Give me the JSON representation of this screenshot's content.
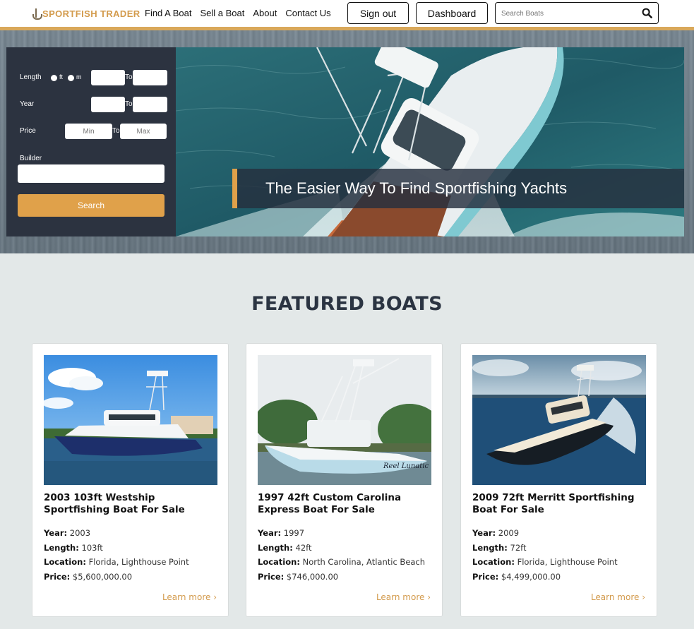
{
  "header": {
    "logo_text": "SPORTFISH TRADER",
    "nav": [
      "Find A Boat",
      "Sell a Boat",
      "About",
      "Contact Us"
    ],
    "signout_label": "Sign out",
    "dashboard_label": "Dashboard",
    "search_placeholder": "Search Boats"
  },
  "search_panel": {
    "length_label": "Length",
    "unit_ft": "ft",
    "unit_m": "m",
    "year_label": "Year",
    "price_label": "Price",
    "to_label": "To",
    "min_placeholder": "Min",
    "max_placeholder": "Max",
    "builder_label": "Builder",
    "search_button": "Search"
  },
  "hero": {
    "caption": "The Easier Way To Find Sportfishing Yachts"
  },
  "featured": {
    "title": "FEATURED BOATS",
    "spec_labels": {
      "year": "Year:",
      "length": "Length:",
      "location": "Location:",
      "price": "Price:"
    },
    "learn_more": "Learn more ›",
    "boats": [
      {
        "title": "2003 103ft Westship Sportfishing Boat For Sale",
        "year": "2003",
        "length": "103ft",
        "location": "Florida, Lighthouse Point",
        "price": "$5,600,000.00"
      },
      {
        "title": "1997 42ft Custom Carolina Express Boat For Sale",
        "year": "1997",
        "length": "42ft",
        "location": "North Carolina, Atlantic Beach",
        "price": "$746,000.00"
      },
      {
        "title": "2009 72ft Merritt Sportfishing Boat For Sale",
        "year": "2009",
        "length": "72ft",
        "location": "Florida, Lighthouse Point",
        "price": "$4,499,000.00"
      }
    ]
  },
  "colors": {
    "accent": "#e0a14a",
    "panel": "#2c3340",
    "title": "#2b3442"
  }
}
